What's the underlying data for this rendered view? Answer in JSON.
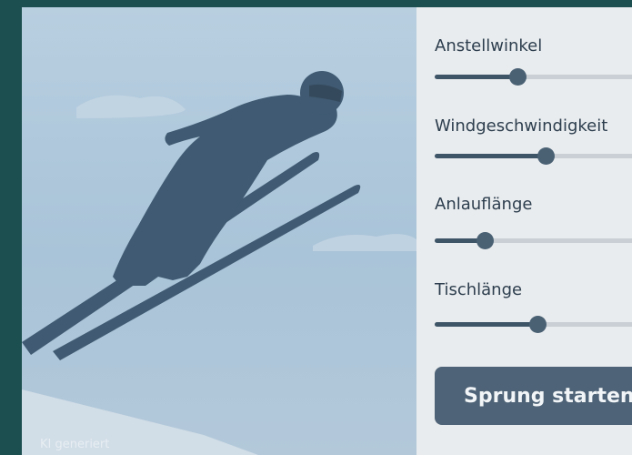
{
  "scene": {
    "badge": "KI generiert",
    "colors": {
      "sky": "#b8cfe0",
      "silhouette": "#3f5a72",
      "snow": "#d7e2ea"
    }
  },
  "controls": [
    {
      "label": "Anstellwinkel",
      "value_fraction": 0.38
    },
    {
      "label": "Windgeschwindigkeit",
      "value_fraction": 0.51
    },
    {
      "label": "Anlauflänge",
      "value_fraction": 0.23
    },
    {
      "label": "Tischlänge",
      "value_fraction": 0.47
    }
  ],
  "actions": {
    "start_label": "Sprung starten"
  },
  "colors": {
    "panel": "#e9ecee",
    "accent": "#4e6377",
    "frame": "#1c4f4f"
  }
}
